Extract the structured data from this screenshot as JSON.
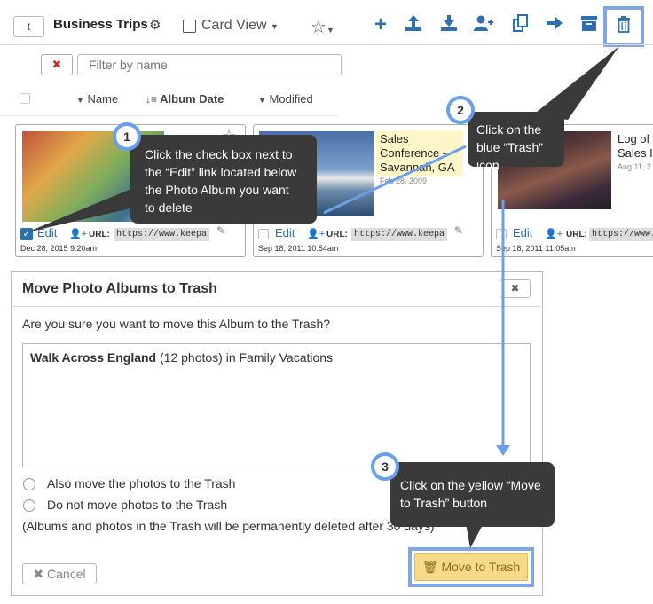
{
  "toolbar": {
    "up_label": "t",
    "title": "Business Trips",
    "card_view_label": "Card View",
    "icons": [
      "plus-icon",
      "upload-icon",
      "download-icon",
      "add-user-icon",
      "copy-icon",
      "arrow-right-icon",
      "archive-icon",
      "trash-icon"
    ]
  },
  "filter": {
    "placeholder": "Filter by name"
  },
  "sort": {
    "name": "Name",
    "album_date": "Album Date",
    "modified": "Modified"
  },
  "cards": [
    {
      "edit": "Edit",
      "url_label": "URL:",
      "url": "https://www.keepa",
      "date": "Dec 28, 2015 9:20am",
      "checked": true
    },
    {
      "title": "Sales Conference - Savannah, GA",
      "album_date": "Feb 28, 2009",
      "edit": "Edit",
      "url_label": "URL:",
      "url": "https://www.keepa",
      "date": "Sep 18, 2011 10:54am"
    },
    {
      "title": "Log of Sales I",
      "album_date": "Aug 11, 2",
      "edit": "Edit",
      "url_label": "URL:",
      "url": "https://www.ke",
      "date": "Sep 18, 2011 11:05am"
    }
  ],
  "dialog": {
    "title": "Move Photo Albums to Trash",
    "question": "Are you sure you want to move this Album to the Trash?",
    "album_name": "Walk Across England",
    "album_detail": " (12 photos) in Family Vacations",
    "option1": "Also move the photos to the Trash",
    "option2": "Do not move photos to the Trash",
    "note": "(Albums and photos in the Trash will be permanently deleted after 30 days)",
    "cancel": "Cancel",
    "move": "Move to Trash"
  },
  "callouts": [
    {
      "num": "1",
      "text": "Click the check box next to the “Edit” link located below the Photo Album you want to delete"
    },
    {
      "num": "2",
      "text": "Click on the blue “Trash” icon"
    },
    {
      "num": "3",
      "text": "Click on the yellow “Move to Trash” button"
    }
  ],
  "colors": {
    "accent": "#2d6fb0",
    "highlight_frame": "#7fa7e6",
    "callout_bg": "#3a3a3a",
    "move_button": "#f7d98a"
  }
}
